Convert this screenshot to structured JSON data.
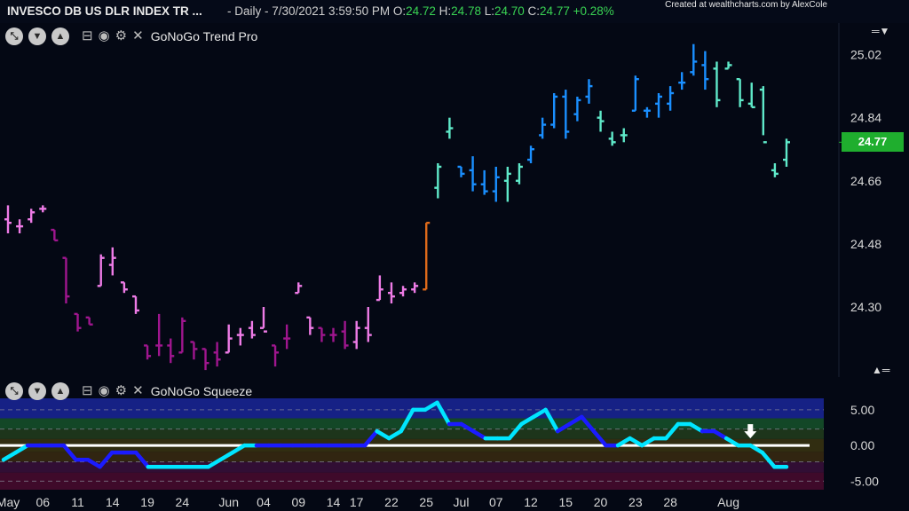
{
  "header": {
    "symbol": "INVESCO DB US DLR INDEX TR ...",
    "quote_prefix": "- Daily - 7/30/2021 3:59:50 PM O:",
    "open": "24.72",
    "h_label": " H:",
    "high": "24.78",
    "l_label": " L:",
    "low": "24.70",
    "c_label": " C:",
    "close": "24.77",
    "change": "+0.28%",
    "credit": "Created at wealthcharts.com by AlexCole"
  },
  "panels": {
    "upper_title": "GoNoGo Trend Pro",
    "lower_title": "GoNoGo Squeeze"
  },
  "last_price": "24.77",
  "colors": {
    "background": "#040814",
    "strong_go": "#1a8fff",
    "weak_go": "#5fe9c9",
    "go_light": "#35c4ff",
    "weak_nogo": "#ee7be6",
    "strong_nogo": "#a0168f",
    "amber": "#e06a1a",
    "squeeze_blue": "#1b1bff",
    "squeeze_cyan": "#00e5ff",
    "price_badge": "#1fae2e"
  },
  "chart_data": [
    {
      "type": "ohlc",
      "title": "GoNoGo Trend Pro",
      "y_ticks": [
        24.3,
        24.48,
        24.66,
        24.84,
        25.02
      ],
      "y_tick_labels": [
        "24.30",
        "24.48",
        "24.66",
        "24.84",
        "25.02"
      ],
      "ylim": [
        24.1,
        25.11
      ],
      "x_tick_labels": [
        "May",
        "06",
        "11",
        "14",
        "19",
        "24",
        "Jun",
        "04",
        "09",
        "14",
        "17",
        "22",
        "25",
        "Jul",
        "07",
        "12",
        "15",
        "20",
        "23",
        "28",
        "Aug"
      ],
      "x_tick_index": [
        0,
        3,
        6,
        9,
        12,
        15,
        19,
        22,
        25,
        28,
        30,
        33,
        36,
        39,
        42,
        45,
        48,
        51,
        54,
        57,
        62
      ],
      "bars": [
        {
          "o": 24.55,
          "h": 24.59,
          "l": 24.51,
          "c": 24.54,
          "t": "weak_nogo"
        },
        {
          "o": 24.53,
          "h": 24.55,
          "l": 24.51,
          "c": 24.53,
          "t": "weak_nogo"
        },
        {
          "o": 24.55,
          "h": 24.58,
          "l": 24.54,
          "c": 24.57,
          "t": "weak_nogo"
        },
        {
          "o": 24.58,
          "h": 24.59,
          "l": 24.57,
          "c": 24.58,
          "t": "weak_nogo"
        },
        {
          "o": 24.52,
          "h": 24.52,
          "l": 24.49,
          "c": 24.49,
          "t": "strong_nogo"
        },
        {
          "o": 24.44,
          "h": 24.44,
          "l": 24.31,
          "c": 24.33,
          "t": "strong_nogo"
        },
        {
          "o": 24.28,
          "h": 24.28,
          "l": 24.23,
          "c": 24.24,
          "t": "strong_nogo"
        },
        {
          "o": 24.27,
          "h": 24.27,
          "l": 24.25,
          "c": 24.25,
          "t": "strong_nogo"
        },
        {
          "o": 24.36,
          "h": 24.45,
          "l": 24.36,
          "c": 24.44,
          "t": "weak_nogo"
        },
        {
          "o": 24.42,
          "h": 24.47,
          "l": 24.39,
          "c": 24.44,
          "t": "weak_nogo"
        },
        {
          "o": 24.37,
          "h": 24.37,
          "l": 24.34,
          "c": 24.35,
          "t": "weak_nogo"
        },
        {
          "o": 24.33,
          "h": 24.33,
          "l": 24.28,
          "c": 24.29,
          "t": "weak_nogo"
        },
        {
          "o": 24.19,
          "h": 24.19,
          "l": 24.15,
          "c": 24.16,
          "t": "strong_nogo"
        },
        {
          "o": 24.19,
          "h": 24.28,
          "l": 24.16,
          "c": 24.19,
          "t": "strong_nogo"
        },
        {
          "o": 24.19,
          "h": 24.21,
          "l": 24.14,
          "c": 24.16,
          "t": "strong_nogo"
        },
        {
          "o": 24.17,
          "h": 24.27,
          "l": 24.17,
          "c": 24.26,
          "t": "strong_nogo"
        },
        {
          "o": 24.2,
          "h": 24.2,
          "l": 24.15,
          "c": 24.18,
          "t": "strong_nogo"
        },
        {
          "o": 24.18,
          "h": 24.18,
          "l": 24.12,
          "c": 24.14,
          "t": "strong_nogo"
        },
        {
          "o": 24.17,
          "h": 24.2,
          "l": 24.13,
          "c": 24.15,
          "t": "strong_nogo"
        },
        {
          "o": 24.17,
          "h": 24.25,
          "l": 24.17,
          "c": 24.21,
          "t": "weak_nogo"
        },
        {
          "o": 24.22,
          "h": 24.24,
          "l": 24.19,
          "c": 24.22,
          "t": "weak_nogo"
        },
        {
          "o": 24.24,
          "h": 24.26,
          "l": 24.21,
          "c": 24.22,
          "t": "weak_nogo"
        },
        {
          "o": 24.24,
          "h": 24.3,
          "l": 24.24,
          "c": 24.23,
          "t": "weak_nogo"
        },
        {
          "o": 24.19,
          "h": 24.19,
          "l": 24.13,
          "c": 24.17,
          "t": "strong_nogo"
        },
        {
          "o": 24.21,
          "h": 24.25,
          "l": 24.18,
          "c": 24.21,
          "t": "strong_nogo"
        },
        {
          "o": 24.34,
          "h": 24.37,
          "l": 24.34,
          "c": 24.36,
          "t": "weak_nogo"
        },
        {
          "o": 24.27,
          "h": 24.27,
          "l": 24.22,
          "c": 24.24,
          "t": "weak_nogo"
        },
        {
          "o": 24.24,
          "h": 24.24,
          "l": 24.2,
          "c": 24.22,
          "t": "strong_nogo"
        },
        {
          "o": 24.22,
          "h": 24.24,
          "l": 24.2,
          "c": 24.22,
          "t": "strong_nogo"
        },
        {
          "o": 24.23,
          "h": 24.26,
          "l": 24.18,
          "c": 24.19,
          "t": "strong_nogo"
        },
        {
          "o": 24.2,
          "h": 24.26,
          "l": 24.18,
          "c": 24.24,
          "t": "weak_nogo"
        },
        {
          "o": 24.24,
          "h": 24.3,
          "l": 24.2,
          "c": 24.22,
          "t": "weak_nogo"
        },
        {
          "o": 24.32,
          "h": 24.39,
          "l": 24.32,
          "c": 24.35,
          "t": "weak_nogo"
        },
        {
          "o": 24.34,
          "h": 24.37,
          "l": 24.31,
          "c": 24.33,
          "t": "weak_nogo"
        },
        {
          "o": 24.34,
          "h": 24.36,
          "l": 24.33,
          "c": 24.35,
          "t": "weak_nogo"
        },
        {
          "o": 24.35,
          "h": 24.37,
          "l": 24.34,
          "c": 24.36,
          "t": "weak_nogo"
        },
        {
          "o": 24.35,
          "h": 24.54,
          "l": 24.35,
          "c": 24.54,
          "t": "amber"
        },
        {
          "o": 24.64,
          "h": 24.71,
          "l": 24.61,
          "c": 24.7,
          "t": "weak_go"
        },
        {
          "o": 24.8,
          "h": 24.84,
          "l": 24.78,
          "c": 24.81,
          "t": "weak_go"
        },
        {
          "o": 24.7,
          "h": 24.7,
          "l": 24.67,
          "c": 24.68,
          "t": "strong_go"
        },
        {
          "o": 24.69,
          "h": 24.73,
          "l": 24.63,
          "c": 24.65,
          "t": "strong_go"
        },
        {
          "o": 24.65,
          "h": 24.69,
          "l": 24.62,
          "c": 24.63,
          "t": "strong_go"
        },
        {
          "o": 24.63,
          "h": 24.7,
          "l": 24.6,
          "c": 24.67,
          "t": "strong_go"
        },
        {
          "o": 24.66,
          "h": 24.7,
          "l": 24.6,
          "c": 24.68,
          "t": "weak_go"
        },
        {
          "o": 24.66,
          "h": 24.71,
          "l": 24.65,
          "c": 24.7,
          "t": "weak_go"
        },
        {
          "o": 24.72,
          "h": 24.76,
          "l": 24.71,
          "c": 24.75,
          "t": "strong_go"
        },
        {
          "o": 24.79,
          "h": 24.84,
          "l": 24.78,
          "c": 24.82,
          "t": "strong_go"
        },
        {
          "o": 24.82,
          "h": 24.91,
          "l": 24.81,
          "c": 24.9,
          "t": "strong_go"
        },
        {
          "o": 24.9,
          "h": 24.92,
          "l": 24.78,
          "c": 24.8,
          "t": "strong_go"
        },
        {
          "o": 24.85,
          "h": 24.9,
          "l": 24.83,
          "c": 24.89,
          "t": "strong_go"
        },
        {
          "o": 24.9,
          "h": 24.95,
          "l": 24.88,
          "c": 24.93,
          "t": "strong_go"
        },
        {
          "o": 24.84,
          "h": 24.86,
          "l": 24.8,
          "c": 24.83,
          "t": "weak_go"
        },
        {
          "o": 24.78,
          "h": 24.8,
          "l": 24.76,
          "c": 24.77,
          "t": "weak_go"
        },
        {
          "o": 24.79,
          "h": 24.81,
          "l": 24.77,
          "c": 24.79,
          "t": "weak_go"
        },
        {
          "o": 24.86,
          "h": 24.96,
          "l": 24.86,
          "c": 24.95,
          "t": "strong_go"
        },
        {
          "o": 24.86,
          "h": 24.87,
          "l": 24.84,
          "c": 24.86,
          "t": "strong_go"
        },
        {
          "o": 24.88,
          "h": 24.91,
          "l": 24.84,
          "c": 24.9,
          "t": "strong_go"
        },
        {
          "o": 24.88,
          "h": 24.93,
          "l": 24.86,
          "c": 24.91,
          "t": "strong_go"
        },
        {
          "o": 24.94,
          "h": 24.97,
          "l": 24.92,
          "c": 24.94,
          "t": "strong_go"
        },
        {
          "o": 24.97,
          "h": 25.05,
          "l": 24.96,
          "c": 25.0,
          "t": "strong_go"
        },
        {
          "o": 24.99,
          "h": 25.03,
          "l": 24.92,
          "c": 24.95,
          "t": "strong_go"
        },
        {
          "o": 24.98,
          "h": 25.0,
          "l": 24.87,
          "c": 24.89,
          "t": "weak_go"
        },
        {
          "o": 24.98,
          "h": 25.0,
          "l": 24.98,
          "c": 24.99,
          "t": "weak_go"
        },
        {
          "o": 24.95,
          "h": 24.95,
          "l": 24.87,
          "c": 24.89,
          "t": "weak_go"
        },
        {
          "o": 24.88,
          "h": 24.94,
          "l": 24.87,
          "c": 24.87,
          "t": "weak_go"
        },
        {
          "o": 24.92,
          "h": 24.93,
          "l": 24.79,
          "c": 24.77,
          "t": "weak_go"
        },
        {
          "o": 24.69,
          "h": 24.71,
          "l": 24.67,
          "c": 24.68,
          "t": "weak_go"
        },
        {
          "o": 24.72,
          "h": 24.78,
          "l": 24.7,
          "c": 24.77,
          "t": "weak_go"
        }
      ]
    },
    {
      "type": "line",
      "title": "GoNoGo Squeeze",
      "y_ticks": [
        5.0,
        0.0,
        -5.0
      ],
      "y_tick_labels": [
        "5.00",
        "0.00",
        "-5.00"
      ],
      "ylim": [
        -6.2,
        6.6
      ],
      "zero_line": 0,
      "values": [
        -2.0,
        -1.0,
        0.0,
        0.0,
        0.0,
        0.0,
        -2.0,
        -2.0,
        -3.0,
        -1.0,
        -1.0,
        -1.0,
        -3.0,
        -3.0,
        -3.0,
        -3.0,
        -3.0,
        -3.0,
        -2.0,
        -1.0,
        0.0,
        0.0,
        0.0,
        0.0,
        0.0,
        0.0,
        0.0,
        0.0,
        0.0,
        0.0,
        0.0,
        2.0,
        1.0,
        2.0,
        5.0,
        5.0,
        6.0,
        3.0,
        3.0,
        2.0,
        1.0,
        1.0,
        1.0,
        3.0,
        4.0,
        5.0,
        2.0,
        3.0,
        4.0,
        2.0,
        0.0,
        0.0,
        1.0,
        0.0,
        1.0,
        1.0,
        3.0,
        3.0,
        2.0,
        2.0,
        1.0,
        0.0,
        0.0,
        -1.0,
        -3.0,
        -3.0
      ],
      "colors": [
        "c",
        "c",
        "b",
        "b",
        "b",
        "b",
        "b",
        "b",
        "b",
        "b",
        "b",
        "b",
        "c",
        "c",
        "c",
        "c",
        "c",
        "c",
        "c",
        "c",
        "c",
        "b",
        "b",
        "b",
        "b",
        "b",
        "b",
        "b",
        "b",
        "b",
        "b",
        "c",
        "c",
        "c",
        "c",
        "c",
        "c",
        "b",
        "b",
        "b",
        "c",
        "c",
        "c",
        "c",
        "c",
        "c",
        "b",
        "b",
        "b",
        "b",
        "b",
        "c",
        "c",
        "c",
        "c",
        "c",
        "c",
        "c",
        "b",
        "b",
        "c",
        "c",
        "c",
        "c",
        "c",
        "c"
      ],
      "arrow_index": 62
    }
  ]
}
